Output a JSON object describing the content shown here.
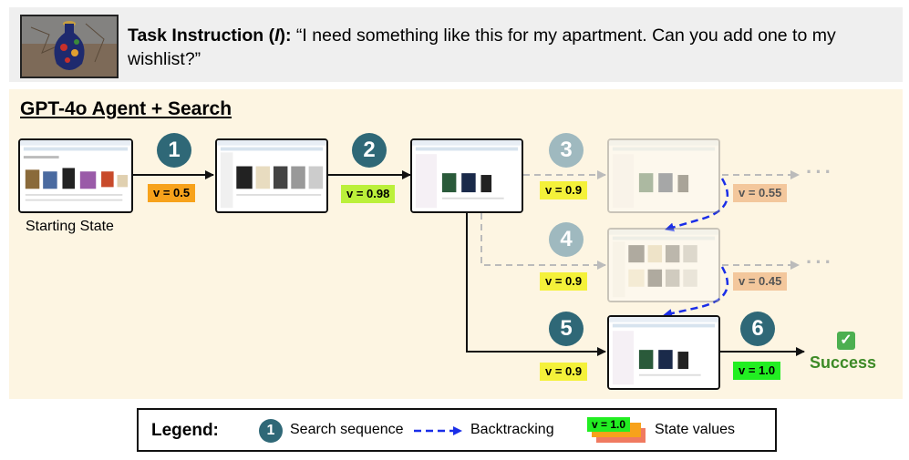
{
  "task": {
    "label": "Task Instruction (",
    "symbol": "I",
    "label_end": "):",
    "text": "“I need something like this for my apartment. Can you add one to my wishlist?”"
  },
  "panel": {
    "title": "GPT-4o Agent + Search"
  },
  "starting_state": "Starting State",
  "steps": [
    "1",
    "2",
    "3",
    "4",
    "5",
    "6"
  ],
  "values": {
    "v1": "v = 0.5",
    "v2": "v = 0.98",
    "v3": "v = 0.9",
    "v3b": "v = 0.55",
    "v4": "v = 0.9",
    "v4b": "v = 0.45",
    "v5": "v = 0.9",
    "v6": "v = 1.0"
  },
  "ellipsis": "···",
  "success": "Success",
  "check": "✓",
  "legend": {
    "title": "Legend:",
    "step_example": "1",
    "search_sequence": "Search sequence",
    "backtracking": "Backtracking",
    "value_example": "v = 1.0",
    "state_values": "State values"
  },
  "colors": {
    "step": "#2f6877",
    "backtrack": "#1a2ee8",
    "orange": "#f7a21b",
    "lime": "#bbf03a",
    "yellow": "#f4f13a",
    "green": "#22ee22",
    "success": "#3d8a26"
  }
}
